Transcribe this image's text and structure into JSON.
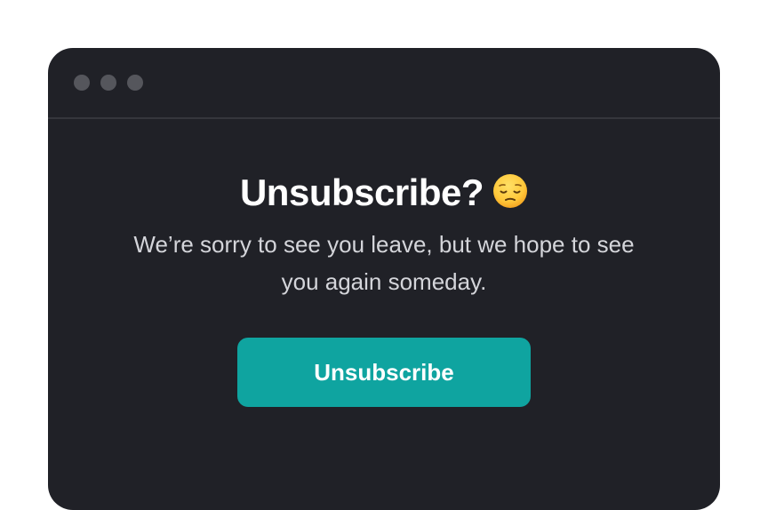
{
  "window": {
    "controls": [
      "window-dot",
      "window-dot",
      "window-dot"
    ]
  },
  "dialog": {
    "title": "Unsubscribe?",
    "title_icon": "pensive-face-emoji",
    "message": "We’re sorry to see you leave, but we hope to see you again someday.",
    "button_label": "Unsubscribe"
  },
  "colors": {
    "background": "#ffffff",
    "window": "#202127",
    "accent": "#0fa4a0",
    "text": "#ffffff",
    "muted_text": "#d4d5da"
  }
}
